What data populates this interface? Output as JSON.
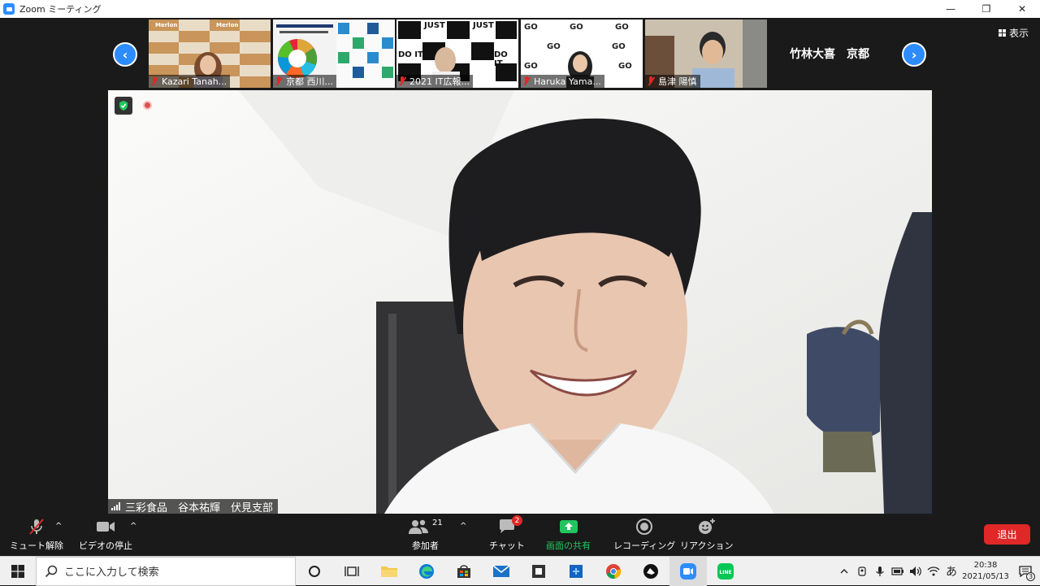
{
  "window": {
    "title": "Zoom ミーティング",
    "minimize": "—",
    "restore": "❐",
    "close": "✕"
  },
  "gallery": {
    "prev_arrow": "‹",
    "next_arrow": "›",
    "view_label": "表示",
    "tiles": [
      {
        "name": "Kazari Tanah..."
      },
      {
        "name": "京都 西川..."
      },
      {
        "name": "2021 IT広報..."
      },
      {
        "name": "Haruka Yama..."
      },
      {
        "name": "島津 陽慎"
      }
    ],
    "text_tile": "竹林大喜　京都",
    "thumb_text": {
      "merlon": "Merlon",
      "justdoit_1": "JUST",
      "justdoit_2": "DO IT.",
      "go": "GO"
    }
  },
  "main_video": {
    "speaker_name": "三彩食品　谷本祐輝　伏見支部"
  },
  "toolbar": {
    "mute_label": "ミュート解除",
    "video_label": "ビデオの停止",
    "participants_label": "参加者",
    "participants_count": "21",
    "chat_label": "チャット",
    "chat_badge": "2",
    "share_label": "画面の共有",
    "record_label": "レコーディング",
    "reaction_label": "リアクション",
    "leave_label": "退出",
    "caret": "^"
  },
  "taskbar": {
    "search_placeholder": "ここに入力して検索",
    "time": "20:38",
    "date": "2021/05/13",
    "ime": "あ",
    "notification_count": "3",
    "line_label": "LINE"
  },
  "colors": {
    "accent": "#2d8cff",
    "danger": "#e02828",
    "share_green": "#22c55e",
    "bg_dark": "#1a1a1a"
  }
}
